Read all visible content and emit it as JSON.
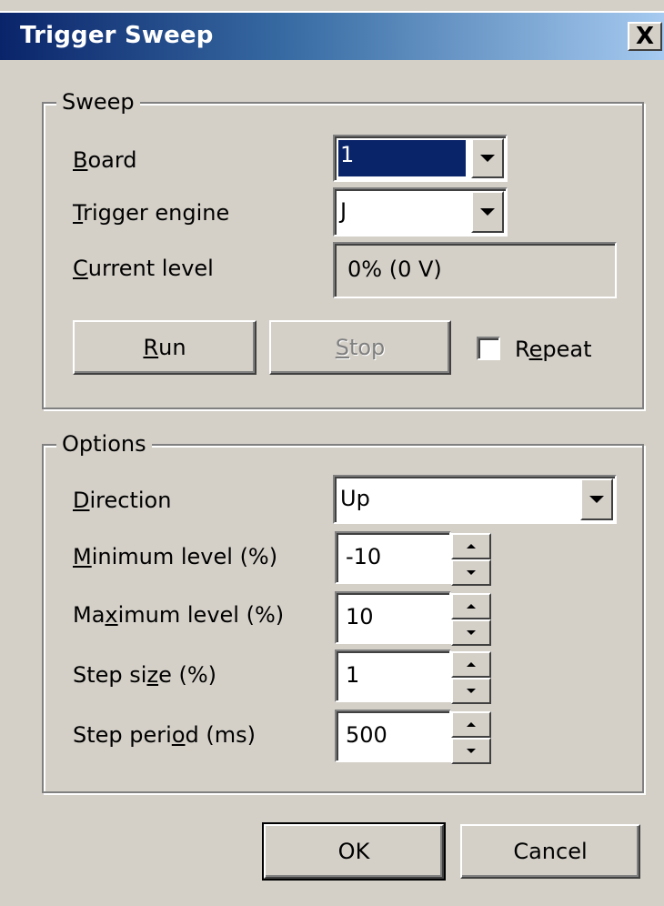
{
  "window": {
    "title": "Trigger Sweep",
    "close_label": "X"
  },
  "sweep": {
    "legend": "Sweep",
    "board": {
      "label_u": "B",
      "label_rest": "oard",
      "value": "1"
    },
    "engine": {
      "label_u": "T",
      "label_rest": "rigger engine",
      "value": "J"
    },
    "current": {
      "label_u": "C",
      "label_rest": "urrent level",
      "value": "0% (0 V)"
    },
    "run": {
      "u": "R",
      "rest": "un"
    },
    "stop": {
      "u": "S",
      "rest": "top"
    },
    "repeat": {
      "pre": "R",
      "u": "e",
      "rest": "peat",
      "checked": false
    }
  },
  "options": {
    "legend": "Options",
    "direction": {
      "label_u": "D",
      "label_rest": "irection",
      "value": "Up"
    },
    "min": {
      "label_u": "M",
      "label_rest": "inimum level (%)",
      "value": "-10"
    },
    "max": {
      "pre": "Ma",
      "u": "x",
      "rest": "imum level (%)",
      "value": "10"
    },
    "step": {
      "pre": "Step si",
      "u": "z",
      "rest": "e (%)",
      "value": "1"
    },
    "period": {
      "pre": "Step peri",
      "u": "o",
      "rest": "d (ms)",
      "value": "500"
    }
  },
  "buttons": {
    "ok": "OK",
    "cancel": "Cancel"
  }
}
